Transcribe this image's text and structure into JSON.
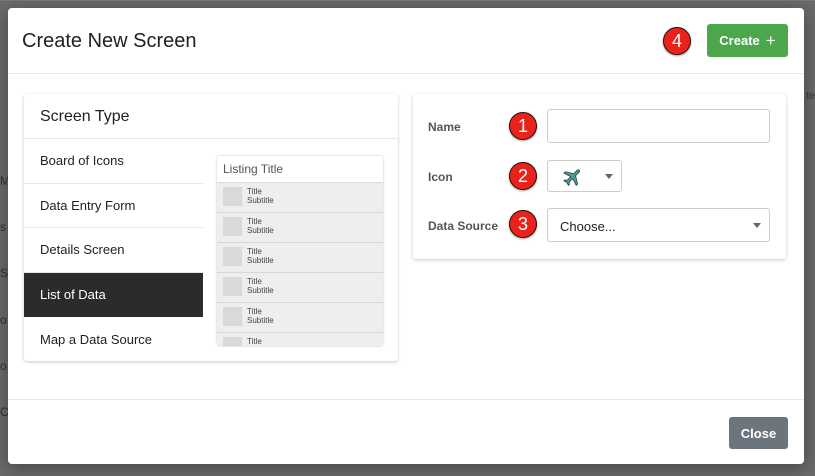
{
  "background": {
    "fragments_left": [
      "M",
      "s",
      "Se",
      "o",
      "o",
      "C"
    ],
    "fragment_right": "r te"
  },
  "modal": {
    "title": "Create New Screen",
    "create_label": "Create",
    "create_icon": "plus-icon",
    "close_label": "Close"
  },
  "badges": [
    "1",
    "2",
    "3",
    "4"
  ],
  "screen_type": {
    "title": "Screen Type",
    "items": [
      "Board of Icons",
      "Data Entry Form",
      "Details Screen",
      "List of Data",
      "Map a Data Source"
    ],
    "selected": "List of Data"
  },
  "preview": {
    "title": "Listing Title",
    "rows": [
      {
        "title": "Title",
        "subtitle": "Subtitle"
      },
      {
        "title": "Title",
        "subtitle": "Subtitle"
      },
      {
        "title": "Title",
        "subtitle": "Subtitle"
      },
      {
        "title": "Title",
        "subtitle": "Subtitle"
      },
      {
        "title": "Title",
        "subtitle": "Subtitle"
      },
      {
        "title": "Title",
        "subtitle": ""
      }
    ]
  },
  "form": {
    "name_label": "Name",
    "name_value": "",
    "icon_label": "Icon",
    "icon_value": "airplane-icon",
    "data_source_label": "Data Source",
    "data_source_value": "Choose..."
  },
  "colors": {
    "create_button": "#4ca64c",
    "close_button": "#6c757d",
    "active_item": "#2b2b2b",
    "badge": "#e8231b",
    "airplane": "#4a9e94"
  }
}
